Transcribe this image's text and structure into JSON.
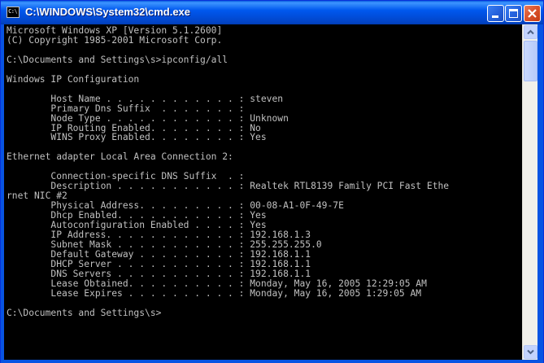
{
  "window": {
    "title": "C:\\WINDOWS\\System32\\cmd.exe",
    "icon_label": "C:\\"
  },
  "titlebar_buttons": {
    "minimize_icon": "minimize-icon",
    "maximize_icon": "maximize-icon",
    "close_icon": "close-icon"
  },
  "console": {
    "lines": [
      "Microsoft Windows XP [Version 5.1.2600]",
      "(C) Copyright 1985-2001 Microsoft Corp.",
      "",
      "C:\\Documents and Settings\\s>ipconfig/all",
      "",
      "Windows IP Configuration",
      "",
      "        Host Name . . . . . . . . . . . . : steven",
      "        Primary Dns Suffix  . . . . . . . :",
      "        Node Type . . . . . . . . . . . . : Unknown",
      "        IP Routing Enabled. . . . . . . . : No",
      "        WINS Proxy Enabled. . . . . . . . : Yes",
      "",
      "Ethernet adapter Local Area Connection 2:",
      "",
      "        Connection-specific DNS Suffix  . :",
      "        Description . . . . . . . . . . . : Realtek RTL8139 Family PCI Fast Ethe",
      "rnet NIC #2",
      "        Physical Address. . . . . . . . . : 00-08-A1-0F-49-7E",
      "        Dhcp Enabled. . . . . . . . . . . : Yes",
      "        Autoconfiguration Enabled . . . . : Yes",
      "        IP Address. . . . . . . . . . . . : 192.168.1.3",
      "        Subnet Mask . . . . . . . . . . . : 255.255.255.0",
      "        Default Gateway . . . . . . . . . : 192.168.1.1",
      "        DHCP Server . . . . . . . . . . . : 192.168.1.1",
      "        DNS Servers . . . . . . . . . . . : 192.168.1.1",
      "        Lease Obtained. . . . . . . . . . : Monday, May 16, 2005 12:29:05 AM",
      "        Lease Expires . . . . . . . . . . : Monday, May 16, 2005 1:29:05 AM",
      "",
      "C:\\Documents and Settings\\s>"
    ]
  },
  "colors": {
    "console_background": "#000000",
    "console_text": "#c0c0c0",
    "titlebar": "#0058ee",
    "close_button": "#d9522b"
  }
}
